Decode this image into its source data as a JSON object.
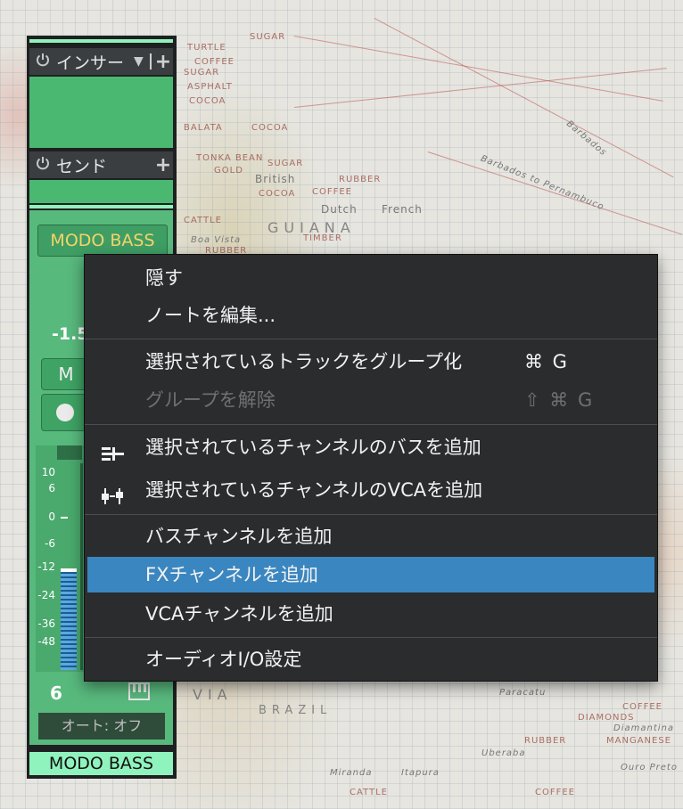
{
  "map": {
    "labels": [
      "TURTLE",
      "SUGAR",
      "COFFEE",
      "SUGAR",
      "ASPHALT",
      "COCOA",
      "BALATA",
      "COCOA",
      "TONKA BEAN",
      "GOLD",
      "British",
      "COCOA",
      "SUGAR",
      "Dutch",
      "French",
      "RUBBER",
      "COFFEE",
      "GUIANA",
      "CATTLE",
      "TIMBER",
      "Boa Vista",
      "RUBBER",
      "BRAZIL",
      "VIA",
      "Paracatu",
      "DIAMONDS",
      "COFFEE",
      "Diamantina",
      "RUBBER",
      "MANGANESE",
      "Uberaba",
      "Ouro Preto",
      "Miranda",
      "Itapura",
      "CATTLE",
      "COFFEE",
      "Barbados to Pernambuco",
      "Barbados"
    ]
  },
  "strip": {
    "insert_label": "インサー",
    "send_label": "センド",
    "channel_name": "MODO BASS",
    "value": "-1.5",
    "mute_label": "M",
    "scale": [
      "10",
      "6",
      "0",
      "-6",
      "-12",
      "-24",
      "-36",
      "-48"
    ],
    "channel_number": "6",
    "auto_label": "オート: オフ",
    "channel_name_bottom": "MODO BASS",
    "icons": {
      "power": "power-icon",
      "plus": "plus-icon",
      "dropdown": "dropdown-arrow-icon",
      "keyboard": "keyboard-icon"
    }
  },
  "menu": {
    "items": [
      {
        "label": "隠す",
        "shortcut": ""
      },
      {
        "label": "ノートを編集...",
        "shortcut": ""
      },
      {
        "label": "選択されているトラックをグループ化",
        "shortcut": "⌘ G"
      },
      {
        "label": "グループを解除",
        "shortcut": "⇧ ⌘ G",
        "disabled": true
      },
      {
        "label": "選択されているチャンネルのバスを追加",
        "shortcut": "",
        "icon": "bus-icon"
      },
      {
        "label": "選択されているチャンネルのVCAを追加",
        "shortcut": "",
        "icon": "vca-icon"
      },
      {
        "label": "バスチャンネルを追加",
        "shortcut": ""
      },
      {
        "label": "FXチャンネルを追加",
        "shortcut": "",
        "selected": true
      },
      {
        "label": "VCAチャンネルを追加",
        "shortcut": ""
      },
      {
        "label": "オーディオI/O設定",
        "shortcut": ""
      }
    ],
    "colors": {
      "background": "#2a2c2e",
      "highlight": "#3a86c0",
      "disabled": "#6e7073"
    }
  },
  "colors": {
    "channel_green": "#58b97d",
    "accent_mint": "#8ff3bd",
    "channel_name_text": "#f6d36a"
  }
}
